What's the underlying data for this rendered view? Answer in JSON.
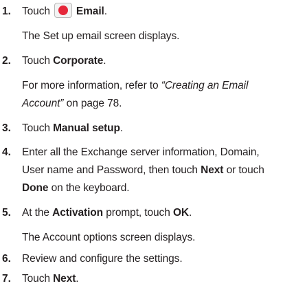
{
  "steps": [
    {
      "num": "1.",
      "pre": "Touch",
      "bold": "Email",
      "post": ".",
      "sub": "The Set up email screen displays."
    },
    {
      "num": "2.",
      "pre": "Touch ",
      "bold": "Corporate",
      "post": ".",
      "sub_pre": "For more information, refer to ",
      "sub_italic_1": "“Creating an Email",
      "sub_italic_2": "Account”",
      "sub_post": " on page 78."
    },
    {
      "num": "3.",
      "pre": "Touch ",
      "bold": "Manual setup",
      "post": "."
    },
    {
      "num": "4.",
      "line1": "Enter all the Exchange server information, Domain,",
      "line2_pre": "User name and Password, then touch ",
      "line2_bold": "Next",
      "line2_post": " or touch",
      "line3_bold": "Done",
      "line3_post": " on the keyboard."
    },
    {
      "num": "5.",
      "pre": "At the ",
      "bold": "Activation",
      "mid": " prompt, touch ",
      "bold2": "OK",
      "post": ".",
      "sub": "The Account options screen displays."
    },
    {
      "num": "6.",
      "text": "Review and configure the settings."
    },
    {
      "num": "7.",
      "pre": "Touch ",
      "bold": "Next",
      "post": "."
    }
  ],
  "icons": {
    "email_icon": "email-app-icon",
    "email_icon_color": "#e5273a"
  }
}
